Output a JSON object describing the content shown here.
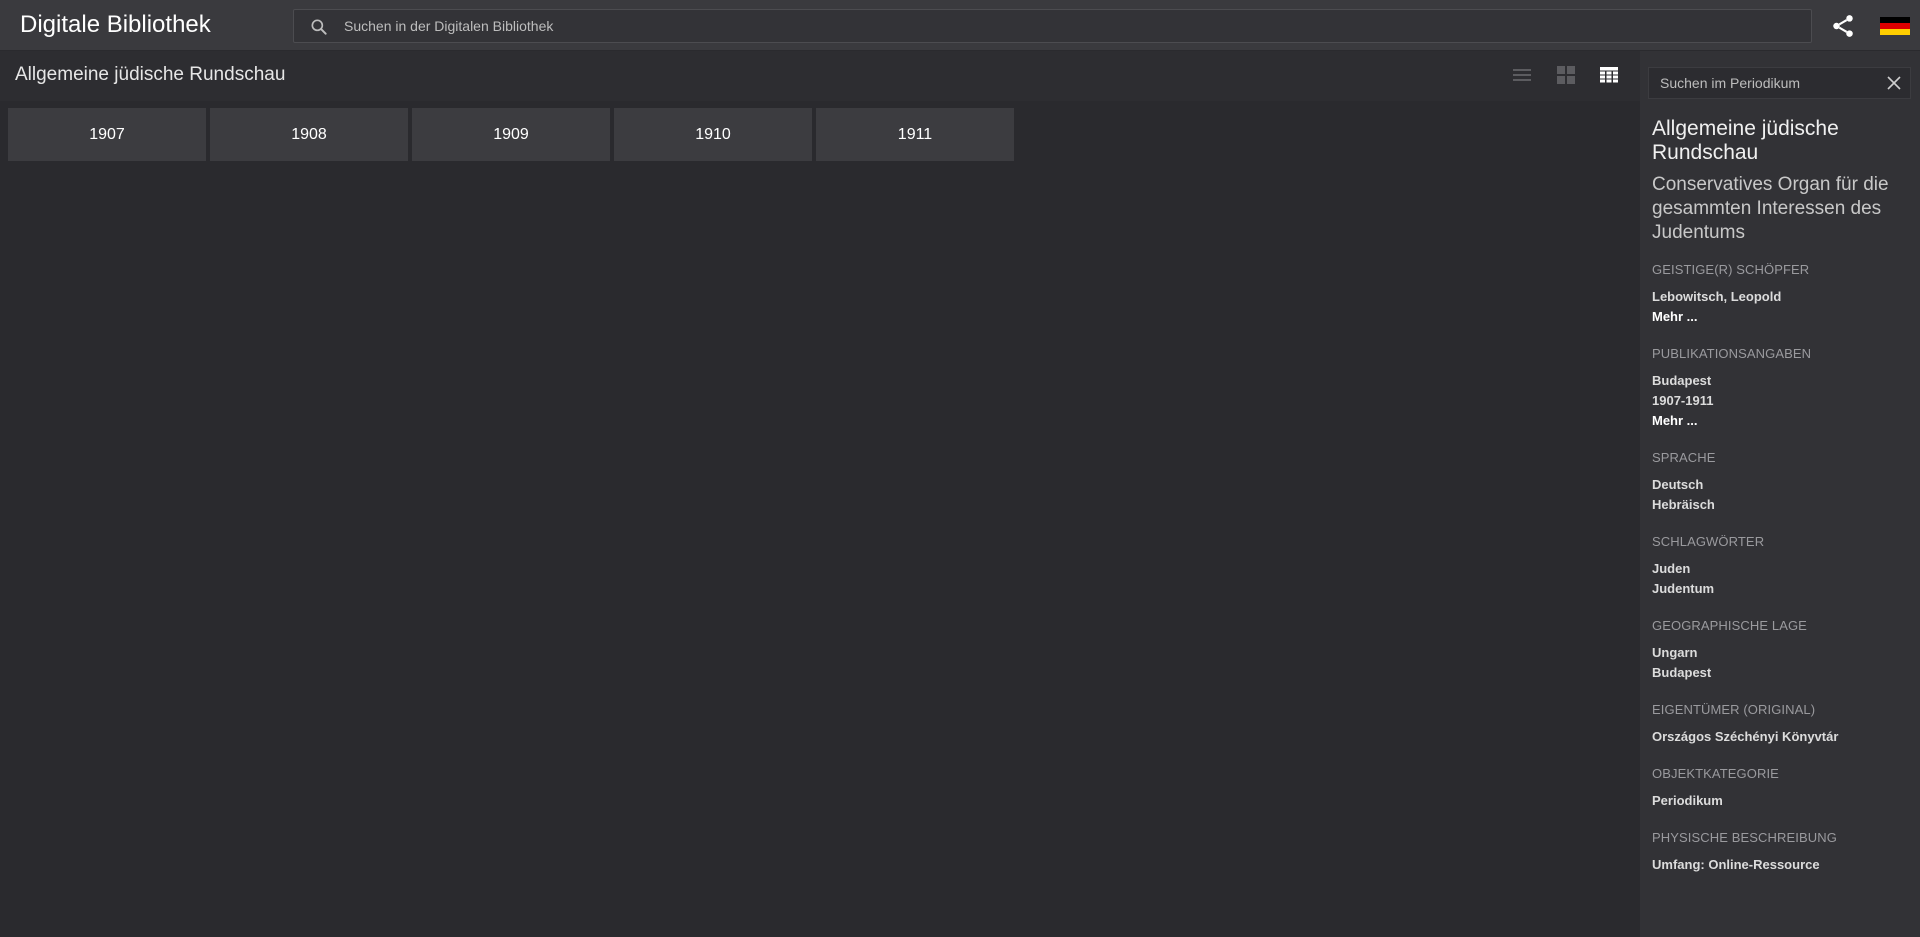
{
  "header": {
    "app_title": "Digitale Bibliothek",
    "search_placeholder": "Suchen in der Digitalen Bibliothek",
    "icons": [
      "search-icon",
      "share-icon",
      "german-flag-icon"
    ],
    "flag_colors": [
      "#000000",
      "#dd0000",
      "#ffce00"
    ]
  },
  "main": {
    "title": "Allgemeine jüdische Rundschau",
    "view_modes": [
      "list-view-icon",
      "grid-view-icon",
      "table-view-icon"
    ],
    "active_view": "table-view-icon",
    "years": [
      "1907",
      "1908",
      "1909",
      "1910",
      "1911"
    ]
  },
  "sidebar": {
    "search_placeholder": "Suchen im Periodikum",
    "title": "Allgemeine jüdische Rundschau",
    "subtitle": "Conservatives Organ für die gesammten Interessen des Judentums",
    "sections": [
      {
        "label": "Geistige(r) Schöpfer",
        "values": [
          "Lebowitsch, Leopold"
        ],
        "more": "Mehr ..."
      },
      {
        "label": "Publikationsangaben",
        "values": [
          "Budapest",
          "1907-1911"
        ],
        "more": "Mehr ..."
      },
      {
        "label": "Sprache",
        "values": [
          "Deutsch",
          "Hebräisch"
        ]
      },
      {
        "label": "Schlagwörter",
        "values": [
          "Juden",
          "Judentum"
        ]
      },
      {
        "label": "Geographische Lage",
        "values": [
          "Ungarn",
          "Budapest"
        ]
      },
      {
        "label": "Eigentümer (Original)",
        "values": [
          "Országos Széchényi Könyvtár"
        ]
      },
      {
        "label": "Objektkategorie",
        "values": [
          "Periodikum"
        ]
      },
      {
        "label": "Physische Beschreibung",
        "values": [
          "Umfang: Online-Ressource"
        ]
      }
    ]
  }
}
